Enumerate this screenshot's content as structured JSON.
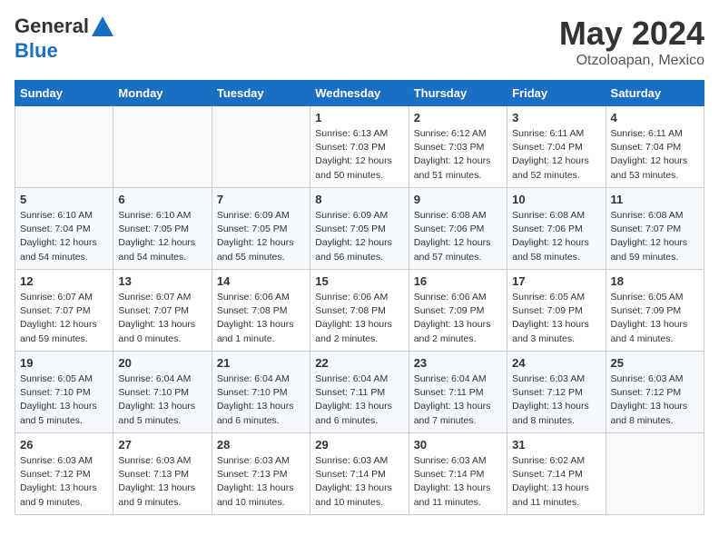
{
  "header": {
    "logo_general": "General",
    "logo_blue": "Blue",
    "month_year": "May 2024",
    "location": "Otzoloapan, Mexico"
  },
  "weekdays": [
    "Sunday",
    "Monday",
    "Tuesday",
    "Wednesday",
    "Thursday",
    "Friday",
    "Saturday"
  ],
  "weeks": [
    [
      {
        "day": null,
        "sunrise": null,
        "sunset": null,
        "daylight": null
      },
      {
        "day": null,
        "sunrise": null,
        "sunset": null,
        "daylight": null
      },
      {
        "day": null,
        "sunrise": null,
        "sunset": null,
        "daylight": null
      },
      {
        "day": "1",
        "sunrise": "6:13 AM",
        "sunset": "7:03 PM",
        "daylight": "12 hours and 50 minutes."
      },
      {
        "day": "2",
        "sunrise": "6:12 AM",
        "sunset": "7:03 PM",
        "daylight": "12 hours and 51 minutes."
      },
      {
        "day": "3",
        "sunrise": "6:11 AM",
        "sunset": "7:04 PM",
        "daylight": "12 hours and 52 minutes."
      },
      {
        "day": "4",
        "sunrise": "6:11 AM",
        "sunset": "7:04 PM",
        "daylight": "12 hours and 53 minutes."
      }
    ],
    [
      {
        "day": "5",
        "sunrise": "6:10 AM",
        "sunset": "7:04 PM",
        "daylight": "12 hours and 54 minutes."
      },
      {
        "day": "6",
        "sunrise": "6:10 AM",
        "sunset": "7:05 PM",
        "daylight": "12 hours and 54 minutes."
      },
      {
        "day": "7",
        "sunrise": "6:09 AM",
        "sunset": "7:05 PM",
        "daylight": "12 hours and 55 minutes."
      },
      {
        "day": "8",
        "sunrise": "6:09 AM",
        "sunset": "7:05 PM",
        "daylight": "12 hours and 56 minutes."
      },
      {
        "day": "9",
        "sunrise": "6:08 AM",
        "sunset": "7:06 PM",
        "daylight": "12 hours and 57 minutes."
      },
      {
        "day": "10",
        "sunrise": "6:08 AM",
        "sunset": "7:06 PM",
        "daylight": "12 hours and 58 minutes."
      },
      {
        "day": "11",
        "sunrise": "6:08 AM",
        "sunset": "7:07 PM",
        "daylight": "12 hours and 59 minutes."
      }
    ],
    [
      {
        "day": "12",
        "sunrise": "6:07 AM",
        "sunset": "7:07 PM",
        "daylight": "12 hours and 59 minutes."
      },
      {
        "day": "13",
        "sunrise": "6:07 AM",
        "sunset": "7:07 PM",
        "daylight": "13 hours and 0 minutes."
      },
      {
        "day": "14",
        "sunrise": "6:06 AM",
        "sunset": "7:08 PM",
        "daylight": "13 hours and 1 minute."
      },
      {
        "day": "15",
        "sunrise": "6:06 AM",
        "sunset": "7:08 PM",
        "daylight": "13 hours and 2 minutes."
      },
      {
        "day": "16",
        "sunrise": "6:06 AM",
        "sunset": "7:09 PM",
        "daylight": "13 hours and 2 minutes."
      },
      {
        "day": "17",
        "sunrise": "6:05 AM",
        "sunset": "7:09 PM",
        "daylight": "13 hours and 3 minutes."
      },
      {
        "day": "18",
        "sunrise": "6:05 AM",
        "sunset": "7:09 PM",
        "daylight": "13 hours and 4 minutes."
      }
    ],
    [
      {
        "day": "19",
        "sunrise": "6:05 AM",
        "sunset": "7:10 PM",
        "daylight": "13 hours and 5 minutes."
      },
      {
        "day": "20",
        "sunrise": "6:04 AM",
        "sunset": "7:10 PM",
        "daylight": "13 hours and 5 minutes."
      },
      {
        "day": "21",
        "sunrise": "6:04 AM",
        "sunset": "7:10 PM",
        "daylight": "13 hours and 6 minutes."
      },
      {
        "day": "22",
        "sunrise": "6:04 AM",
        "sunset": "7:11 PM",
        "daylight": "13 hours and 6 minutes."
      },
      {
        "day": "23",
        "sunrise": "6:04 AM",
        "sunset": "7:11 PM",
        "daylight": "13 hours and 7 minutes."
      },
      {
        "day": "24",
        "sunrise": "6:03 AM",
        "sunset": "7:12 PM",
        "daylight": "13 hours and 8 minutes."
      },
      {
        "day": "25",
        "sunrise": "6:03 AM",
        "sunset": "7:12 PM",
        "daylight": "13 hours and 8 minutes."
      }
    ],
    [
      {
        "day": "26",
        "sunrise": "6:03 AM",
        "sunset": "7:12 PM",
        "daylight": "13 hours and 9 minutes."
      },
      {
        "day": "27",
        "sunrise": "6:03 AM",
        "sunset": "7:13 PM",
        "daylight": "13 hours and 9 minutes."
      },
      {
        "day": "28",
        "sunrise": "6:03 AM",
        "sunset": "7:13 PM",
        "daylight": "13 hours and 10 minutes."
      },
      {
        "day": "29",
        "sunrise": "6:03 AM",
        "sunset": "7:14 PM",
        "daylight": "13 hours and 10 minutes."
      },
      {
        "day": "30",
        "sunrise": "6:03 AM",
        "sunset": "7:14 PM",
        "daylight": "13 hours and 11 minutes."
      },
      {
        "day": "31",
        "sunrise": "6:02 AM",
        "sunset": "7:14 PM",
        "daylight": "13 hours and 11 minutes."
      },
      {
        "day": null,
        "sunrise": null,
        "sunset": null,
        "daylight": null
      }
    ]
  ],
  "labels": {
    "sunrise": "Sunrise:",
    "sunset": "Sunset:",
    "daylight": "Daylight:"
  }
}
